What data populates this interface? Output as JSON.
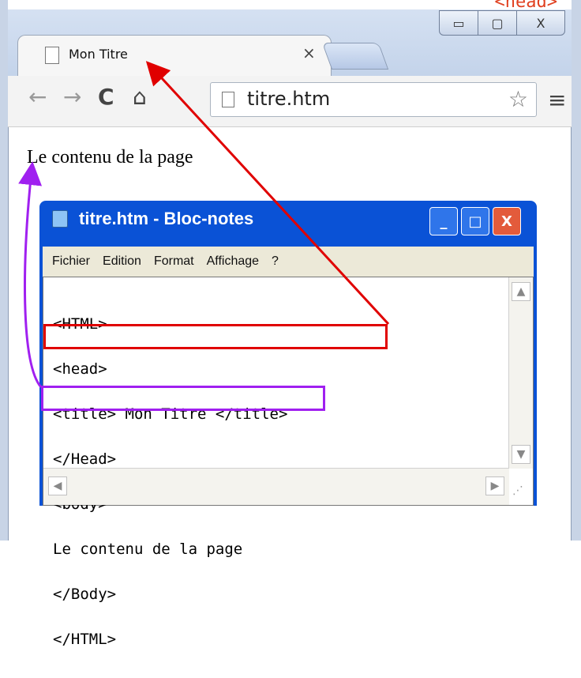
{
  "top_strip_text": "<head>",
  "window": {
    "controls": {
      "minimize": "▭",
      "maximize": "▢",
      "close": "X"
    }
  },
  "tab": {
    "title": "Mon Titre",
    "close": "×"
  },
  "toolbar": {
    "back": "←",
    "forward": "→",
    "reload": "C",
    "home": "⌂",
    "address": "titre.htm",
    "star": "☆",
    "menu": "≡"
  },
  "page": {
    "content": "Le contenu de la page"
  },
  "notepad": {
    "title": "titre.htm - Bloc-notes",
    "menu": [
      "Fichier",
      "Edition",
      "Format",
      "Affichage",
      "?"
    ],
    "lines": [
      "<HTML>",
      "<head>",
      "<title> Mon Titre </title>",
      "</Head>",
      "<body>",
      "Le contenu de la page",
      "</Body>",
      "</HTML>"
    ],
    "controls": {
      "minimize": "_",
      "maximize": "□",
      "close": "X"
    }
  },
  "annotations": {
    "red_color": "#e00000",
    "purple_color": "#a020f0"
  }
}
